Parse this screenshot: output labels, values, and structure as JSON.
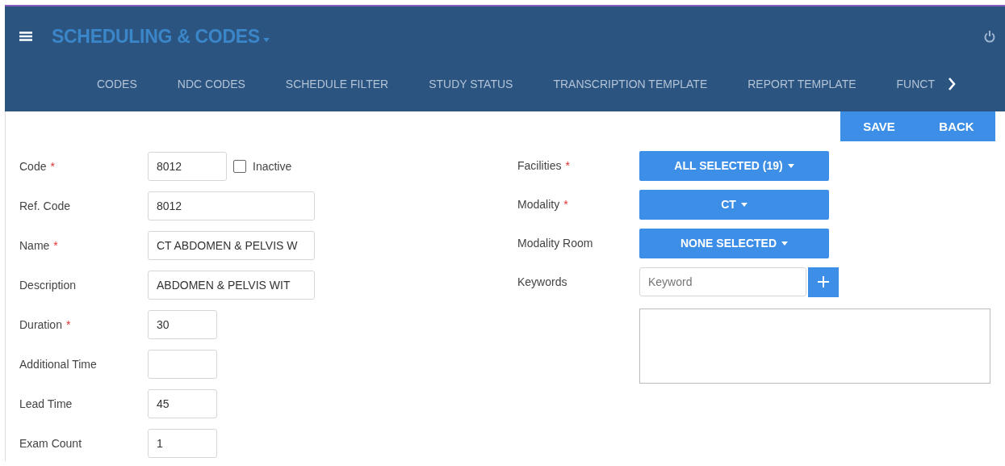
{
  "header": {
    "title": "SCHEDULING & CODES"
  },
  "tabs": [
    {
      "label": "CODES"
    },
    {
      "label": "NDC CODES"
    },
    {
      "label": "SCHEDULE FILTER"
    },
    {
      "label": "STUDY STATUS"
    },
    {
      "label": "TRANSCRIPTION TEMPLATE"
    },
    {
      "label": "REPORT TEMPLATE"
    },
    {
      "label": "FUNCT"
    }
  ],
  "actions": [
    "SAVE",
    "BACK"
  ],
  "left_fields": [
    {
      "label": "Code",
      "required_mark": "*",
      "kind": "medium",
      "value": "8012",
      "checkbox": {
        "label": "Inactive",
        "checked": false
      }
    },
    {
      "label": "Ref. Code",
      "kind": "long",
      "value": "8012"
    },
    {
      "label": "Name",
      "required_mark": "*",
      "kind": "long",
      "value": "CT ABDOMEN & PELVIS W"
    },
    {
      "label": "Description",
      "kind": "long",
      "value": "ABDOMEN & PELVIS WIT"
    },
    {
      "label": "Duration",
      "required_mark": "*",
      "kind": "short",
      "value": "30"
    },
    {
      "label": "Additional Time",
      "kind": "short"
    },
    {
      "label": "Lead Time",
      "kind": "short",
      "value": "45"
    },
    {
      "label": "Exam Count",
      "kind": "short",
      "value": "1"
    }
  ],
  "right_fields": [
    {
      "label": "Facilities",
      "required_mark": "*",
      "kind": "dropdown",
      "value": "ALL SELECTED (19)"
    },
    {
      "label": "Modality",
      "required_mark": "*",
      "kind": "dropdown",
      "value": "CT"
    },
    {
      "label": "Modality Room",
      "kind": "dropdown",
      "value": "NONE SELECTED"
    },
    {
      "label": "Keywords",
      "kind": "keyword",
      "placeholder": "Keyword"
    }
  ],
  "keywords_list": {
    "kind": "textarea"
  }
}
